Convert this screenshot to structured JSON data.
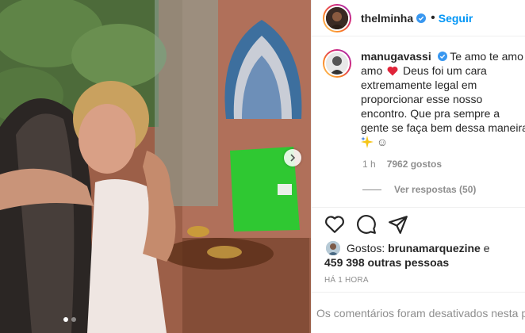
{
  "post": {
    "author": "thelminha",
    "follow_label": "Seguir",
    "separator": "•"
  },
  "comment": {
    "author": "manugavassi",
    "text_part1": "Te amo te amo te",
    "text_part2": "amo",
    "text_part3": "Deus foi um cara",
    "text_lines": [
      "extremamente legal em",
      "proporcionar esse nosso",
      "encontro. Que pra sempre a",
      "gente se faça bem dessa maneira"
    ],
    "emoji_tail": "☺",
    "time": "1 h",
    "likes": "7962 gostos",
    "view_replies": "Ver respostas (50)"
  },
  "likes": {
    "prefix": "Gostos:",
    "first_user": "brunamarquezine",
    "connector": "e",
    "others": "459 398 outras pessoas"
  },
  "timestamp": "HÁ 1 HORA",
  "comments_disabled": "Os comentários foram desativados nesta pu",
  "colors": {
    "accent": "#0095f6",
    "verified": "#3897f0",
    "heart": "#ed4956"
  }
}
